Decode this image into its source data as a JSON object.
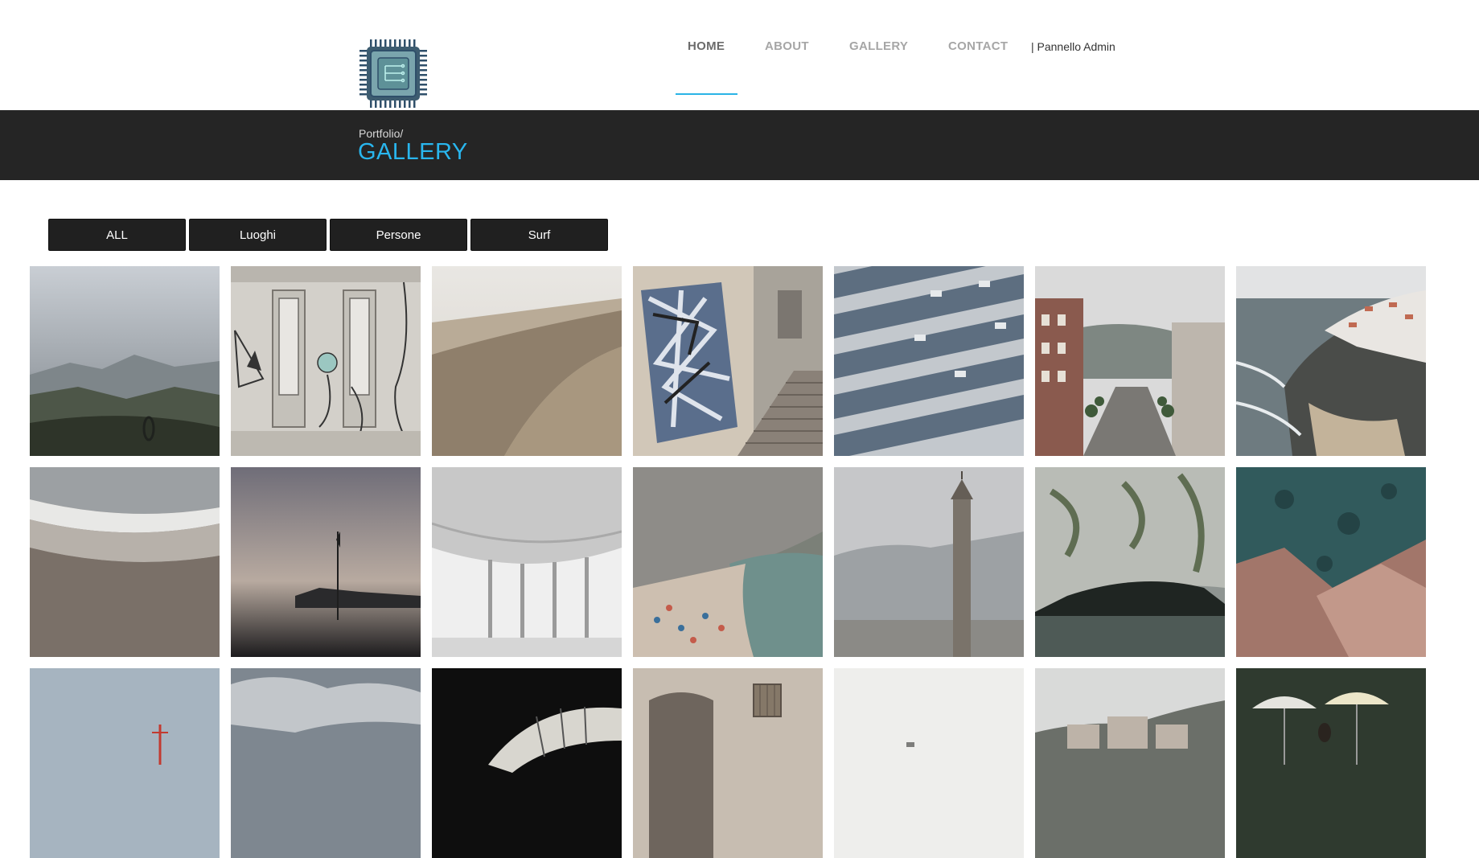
{
  "nav": {
    "items": [
      {
        "label": "HOME",
        "active": true
      },
      {
        "label": "ABOUT",
        "active": false
      },
      {
        "label": "GALLERY",
        "active": false
      },
      {
        "label": "CONTACT",
        "active": false
      }
    ],
    "admin_label": "| Pannello Admin"
  },
  "logo": {
    "icon": "cpu-chip-icon"
  },
  "breadcrumb": "Portfolio/",
  "page_title": "GALLERY",
  "filters": [
    "ALL",
    "Luoghi",
    "Persone",
    "Surf"
  ],
  "colors": {
    "accent": "#29b6ee",
    "title_bar": "#252525",
    "filter_button": "#202020"
  },
  "gallery": {
    "rows": [
      [
        "misty-hills-photo",
        "abandoned-room-mural-photo",
        "desert-dune-photo",
        "geometric-mural-stairs-photo",
        "glass-building-facade-photo",
        "city-street-photo",
        "cliff-village-sea-photo"
      ],
      [
        "beach-waves-aerial-photo",
        "sunset-pier-photo",
        "modern-pavilion-photo",
        "crowded-beach-cliff-photo",
        "florence-tower-photo",
        "sea-cave-photo",
        "rocky-coast-aerial-photo"
      ],
      [
        "harbor-sky-photo",
        "cloudy-sky-photo",
        "dark-arch-interior-photo",
        "old-building-window-photo",
        "foggy-landscape-photo",
        "hillside-town-photo",
        "beach-umbrellas-photo"
      ]
    ]
  }
}
